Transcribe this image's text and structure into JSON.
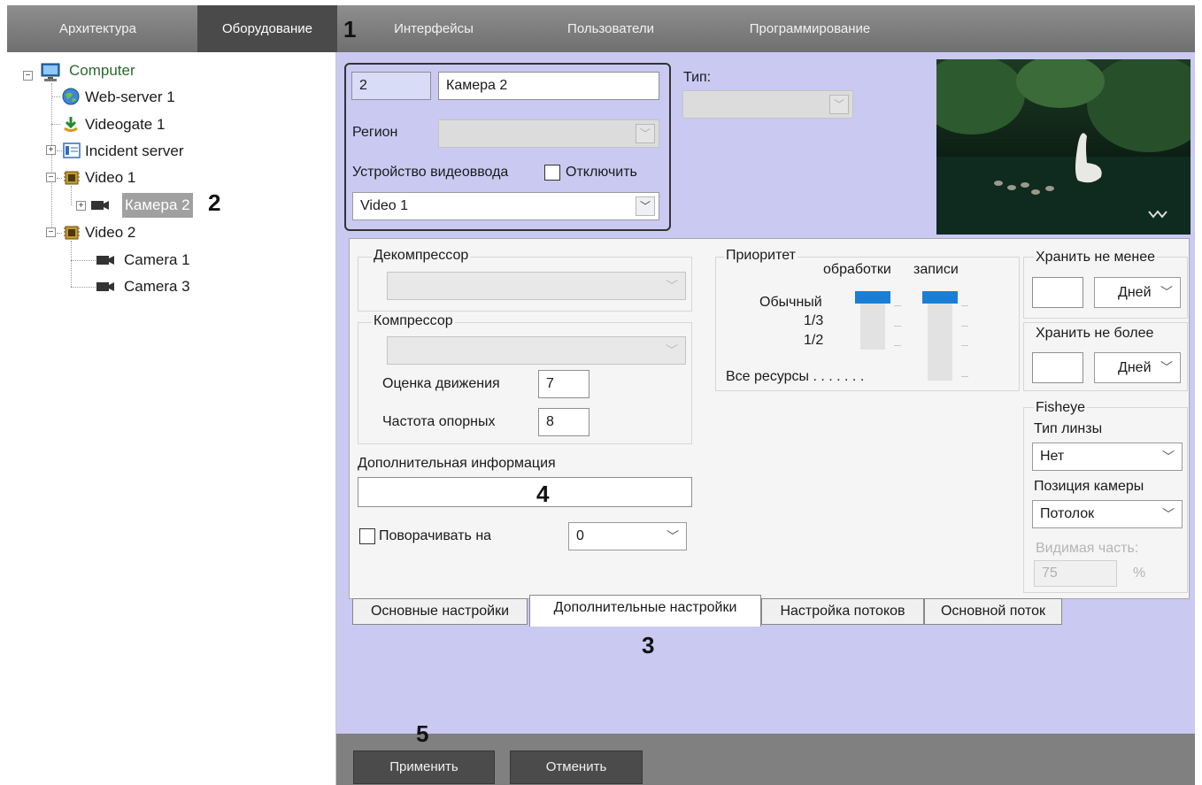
{
  "top_tabs": [
    {
      "label": "Архитектура"
    },
    {
      "label": "Оборудование"
    },
    {
      "label": "Интерфейсы"
    },
    {
      "label": "Пользователи"
    },
    {
      "label": "Программирование"
    }
  ],
  "annotations": {
    "n1": "1",
    "n2": "2",
    "n3": "3",
    "n4": "4",
    "n5": "5"
  },
  "tree": {
    "computer": "Computer",
    "web_server": "Web-server 1",
    "videogate": "Videogate 1",
    "incident_server": "Incident server",
    "video1": "Video 1",
    "camera2": "Камера 2",
    "video2": "Video 2",
    "camera1": "Camera 1",
    "camera3": "Camera 3"
  },
  "device": {
    "id_value": "2",
    "name_value": "Камера 2",
    "type_label": "Тип:",
    "type_value": "",
    "region_label": "Регион",
    "region_value": "",
    "capture_label": "Устройство видеоввода",
    "disable_label": "Отключить",
    "capture_value": "Video 1"
  },
  "decompressor": {
    "label": "Декомпрессор",
    "value": ""
  },
  "compressor": {
    "label": "Компрессор",
    "value": "",
    "motion_label": "Оценка движения",
    "motion_value": "7",
    "keyframe_label": "Частота опорных",
    "keyframe_value": "8"
  },
  "priority": {
    "label": "Приоритет",
    "processing_label": "обработки",
    "recording_label": "записи",
    "level_normal": "Обычный",
    "level_third": "1/3",
    "level_half": "1/2",
    "level_all": "Все ресурсы . . . . . . .",
    "processing_level": "Обычный",
    "recording_level": "Обычный"
  },
  "storage": {
    "min_label": "Хранить не менее",
    "min_value": "",
    "min_unit": "Дней",
    "max_label": "Хранить не более",
    "max_value": "",
    "max_unit": "Дней"
  },
  "fisheye": {
    "label": "Fisheye",
    "lens_label": "Тип линзы",
    "lens_value": "Нет",
    "position_label": "Позиция камеры",
    "position_value": "Потолок",
    "visible_label": "Видимая часть:",
    "visible_value": "75",
    "visible_unit": "%"
  },
  "extra_info": {
    "label": "Дополнительная информация",
    "value": ""
  },
  "rotate": {
    "label": "Поворачивать на",
    "value": "0"
  },
  "inner_tabs": [
    {
      "label": "Основные настройки"
    },
    {
      "label": "Дополнительные настройки"
    },
    {
      "label": "Настройка потоков"
    },
    {
      "label": "Основной поток"
    }
  ],
  "buttons": {
    "apply": "Применить",
    "cancel": "Отменить"
  },
  "colors": {
    "panel_bg": "#c9c9f2",
    "accent": "#1a7fd4",
    "topbar": "#7f7f7f"
  }
}
